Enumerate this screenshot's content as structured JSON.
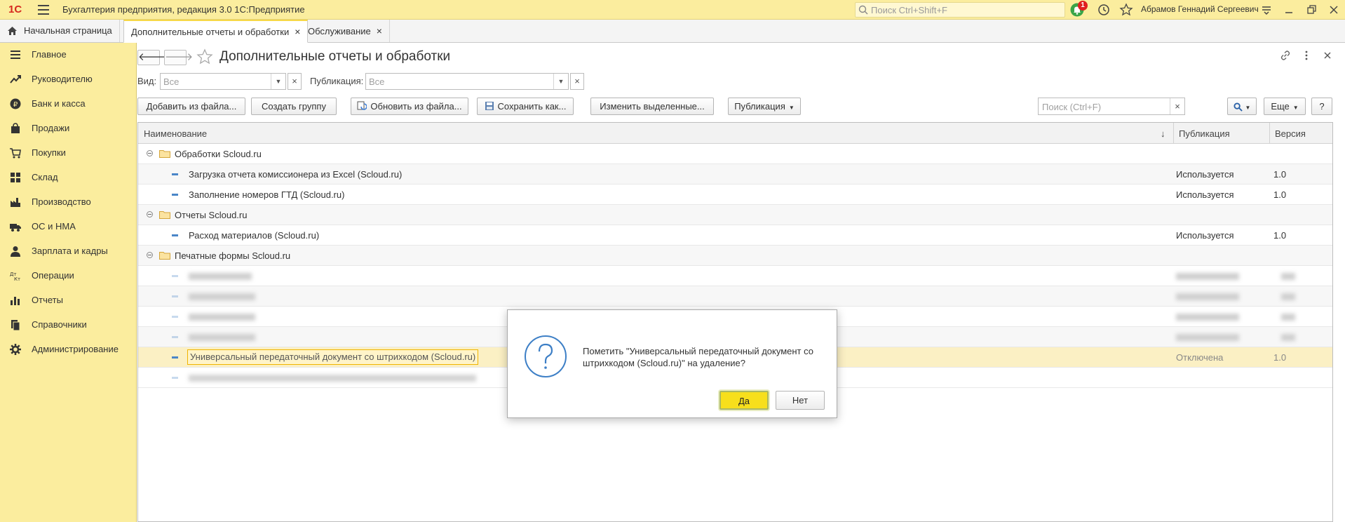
{
  "titlebar": {
    "logo": "1С",
    "app_title": "Бухгалтерия предприятия, редакция 3.0 1С:Предприятие",
    "search_placeholder": "Поиск Ctrl+Shift+F",
    "notification_count": "1",
    "user_name": "Абрамов Геннадий Сергеевич"
  },
  "tabs": [
    {
      "label": "Начальная страница"
    },
    {
      "label": "Дополнительные отчеты и обработки",
      "close": "×"
    },
    {
      "label": "Обслуживание",
      "close": "×"
    }
  ],
  "sidebar": {
    "items": [
      {
        "label": "Главное",
        "icon": "menu-icon"
      },
      {
        "label": "Руководителю",
        "icon": "trend-icon"
      },
      {
        "label": "Банк и касса",
        "icon": "ruble-icon"
      },
      {
        "label": "Продажи",
        "icon": "bag-icon"
      },
      {
        "label": "Покупки",
        "icon": "cart-icon"
      },
      {
        "label": "Склад",
        "icon": "warehouse-icon"
      },
      {
        "label": "Производство",
        "icon": "factory-icon"
      },
      {
        "label": "ОС и НМА",
        "icon": "truck-icon"
      },
      {
        "label": "Зарплата и кадры",
        "icon": "person-icon"
      },
      {
        "label": "Операции",
        "icon": "dt-kt-icon"
      },
      {
        "label": "Отчеты",
        "icon": "bar-chart-icon"
      },
      {
        "label": "Справочники",
        "icon": "books-icon"
      },
      {
        "label": "Администрирование",
        "icon": "gear-icon"
      }
    ]
  },
  "page": {
    "title": "Дополнительные отчеты и обработки",
    "back": "🡐",
    "forward": "🡒"
  },
  "filters": {
    "view_label": "Вид:",
    "view_placeholder": "Все",
    "publication_label": "Публикация:",
    "publication_placeholder": "Все"
  },
  "toolbar": {
    "add_from_file": "Добавить из файла...",
    "create_group": "Создать группу",
    "update_from_file": "Обновить из файла...",
    "save_as": "Сохранить как...",
    "change_selected": "Изменить выделенные...",
    "publication": "Публикация",
    "search_placeholder": "Поиск (Ctrl+F)",
    "more": "Еще",
    "help": "?"
  },
  "grid": {
    "columns": [
      "Наименование",
      "Публикация",
      "Версия"
    ],
    "sort_indicator": "↓",
    "rows": [
      {
        "kind": "group",
        "name": "Обработки Scloud.ru"
      },
      {
        "kind": "item",
        "name": "Загрузка отчета комиссионера из Excel (Scloud.ru)",
        "publication": "Используется",
        "version": "1.0"
      },
      {
        "kind": "item",
        "name": "Заполнение номеров ГТД (Scloud.ru)",
        "publication": "Используется",
        "version": "1.0"
      },
      {
        "kind": "group",
        "name": "Отчеты Scloud.ru"
      },
      {
        "kind": "item",
        "name": "Расход материалов (Scloud.ru)",
        "publication": "Используется",
        "version": "1.0"
      },
      {
        "kind": "group",
        "name": "Печатные формы Scloud.ru"
      },
      {
        "kind": "blurred"
      },
      {
        "kind": "blurred"
      },
      {
        "kind": "blurred"
      },
      {
        "kind": "blurred"
      },
      {
        "kind": "selected",
        "name": "Универсальный передаточный документ со штрихкодом (Scloud.ru)",
        "publication": "Отключена",
        "version": "1.0"
      },
      {
        "kind": "blurred"
      }
    ]
  },
  "dialog": {
    "message": "Пометить \"Универсальный передаточный документ со штрихкодом (Scloud.ru)\" на удаление?",
    "yes": "Да",
    "no": "Нет"
  }
}
